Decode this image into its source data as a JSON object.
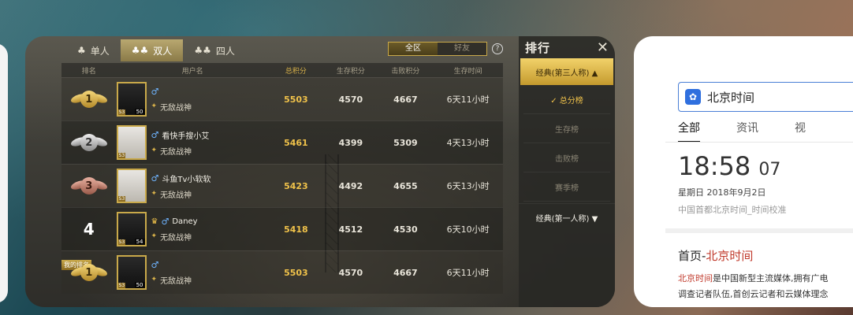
{
  "game": {
    "modes": [
      {
        "label": "单人",
        "icon": "solo-icon",
        "active": false
      },
      {
        "label": "双人",
        "icon": "duo-icon",
        "active": true
      },
      {
        "label": "四人",
        "icon": "squad-icon",
        "active": false
      }
    ],
    "scope": {
      "all": "全区",
      "friends": "好友",
      "selected": "全区"
    },
    "help": "?",
    "columns": [
      "排名",
      "用户名",
      "总积分",
      "生存积分",
      "击败积分",
      "生存时间"
    ],
    "rows": [
      {
        "rank": "1",
        "rank_badge": "gold",
        "name": "",
        "gender": "♂",
        "title": "无敌战神",
        "level": "50",
        "season": "S3",
        "total": "5503",
        "survival": "4570",
        "kill": "4667",
        "time": "6天11小时"
      },
      {
        "rank": "2",
        "rank_badge": "silver",
        "name": "看快手搜小艾",
        "gender": "♂",
        "title": "无敌战神",
        "level": "",
        "season": "S3",
        "total": "5461",
        "survival": "4399",
        "kill": "5309",
        "time": "4天13小时"
      },
      {
        "rank": "3",
        "rank_badge": "bronze",
        "name": "斗鱼Tv小软软",
        "gender": "♂",
        "title": "无敌战神",
        "level": "",
        "season": "S3",
        "total": "5423",
        "survival": "4492",
        "kill": "4655",
        "time": "6天13小时"
      },
      {
        "rank": "4",
        "rank_badge": "none",
        "name": "Daney",
        "gender": "♂",
        "title": "无敌战神",
        "level": "54",
        "season": "S3",
        "total": "5418",
        "survival": "4512",
        "kill": "4530",
        "time": "6天10小时"
      },
      {
        "rank": "1",
        "rank_badge": "gold",
        "name": "",
        "gender": "♂",
        "title": "无敌战神",
        "level": "50",
        "season": "S3",
        "total": "5503",
        "survival": "4570",
        "kill": "4667",
        "time": "6天11小时",
        "my_rank_label": "我的排名"
      }
    ],
    "side": {
      "title": "排行",
      "category": "经典(第三人称) ▲",
      "subs": [
        {
          "label": "✓ 总分榜",
          "active": true
        },
        {
          "label": "生存榜",
          "active": false
        },
        {
          "label": "击败榜",
          "active": false
        },
        {
          "label": "赛季榜",
          "active": false
        }
      ],
      "category2": "经典(第一人称) ▼"
    },
    "colors": {
      "gold": "#f0c24a",
      "accent": "#c9a94a"
    }
  },
  "browser": {
    "search_text": "北京时间",
    "tabs": [
      "全部",
      "资讯",
      "视"
    ],
    "clock": "18:58",
    "seconds": "07",
    "date": "星期日 2018年9月2日",
    "source": "中国首都北京时间_时间校准",
    "result_title_prefix": "首页-",
    "result_title_link": "北京时间",
    "desc_line1_link": "北京时间",
    "desc_line1_rest": "是中国新型主流媒体,拥有广电",
    "desc_line2": "调查记者队伍,首创云记者和云媒体理念"
  }
}
